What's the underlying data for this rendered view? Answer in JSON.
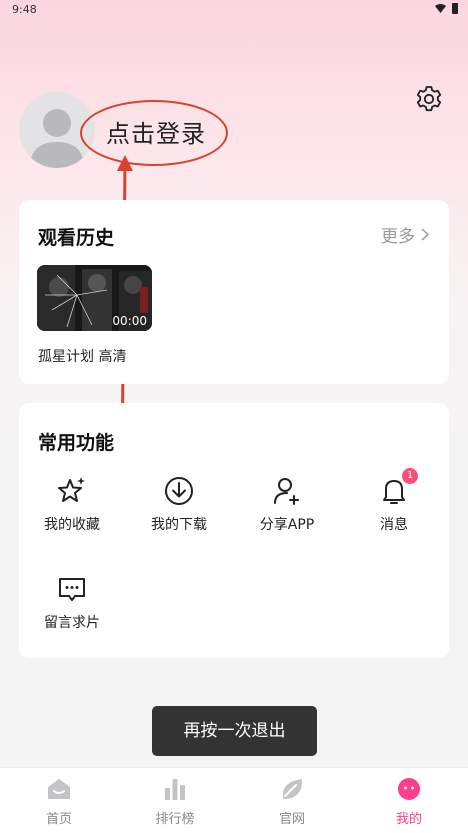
{
  "status_bar": {
    "time": "9:48"
  },
  "profile": {
    "login_text": "点击登录"
  },
  "history": {
    "title": "观看历史",
    "more_label": "更多",
    "items": [
      {
        "title": "孤星计划 高清",
        "duration": "00:00"
      }
    ]
  },
  "functions": {
    "title": "常用功能",
    "items": [
      {
        "label": "我的收藏",
        "icon": "star-sparkle-icon"
      },
      {
        "label": "我的下载",
        "icon": "download-icon"
      },
      {
        "label": "分享APP",
        "icon": "user-add-icon"
      },
      {
        "label": "消息",
        "icon": "bell-icon",
        "badge": "1"
      },
      {
        "label": "留言求片",
        "icon": "message-icon"
      }
    ]
  },
  "toast": {
    "text": "再按一次退出"
  },
  "tab_bar": {
    "tabs": [
      {
        "label": "首页",
        "icon": "home-icon",
        "active": false
      },
      {
        "label": "排行榜",
        "icon": "ranking-icon",
        "active": false
      },
      {
        "label": "官网",
        "icon": "leaf-icon",
        "active": false
      },
      {
        "label": "我的",
        "icon": "profile-face-icon",
        "active": true
      }
    ]
  },
  "colors": {
    "accent": "#ff3f8e",
    "annotation": "#d9422e",
    "badge": "#ff4d7a"
  }
}
